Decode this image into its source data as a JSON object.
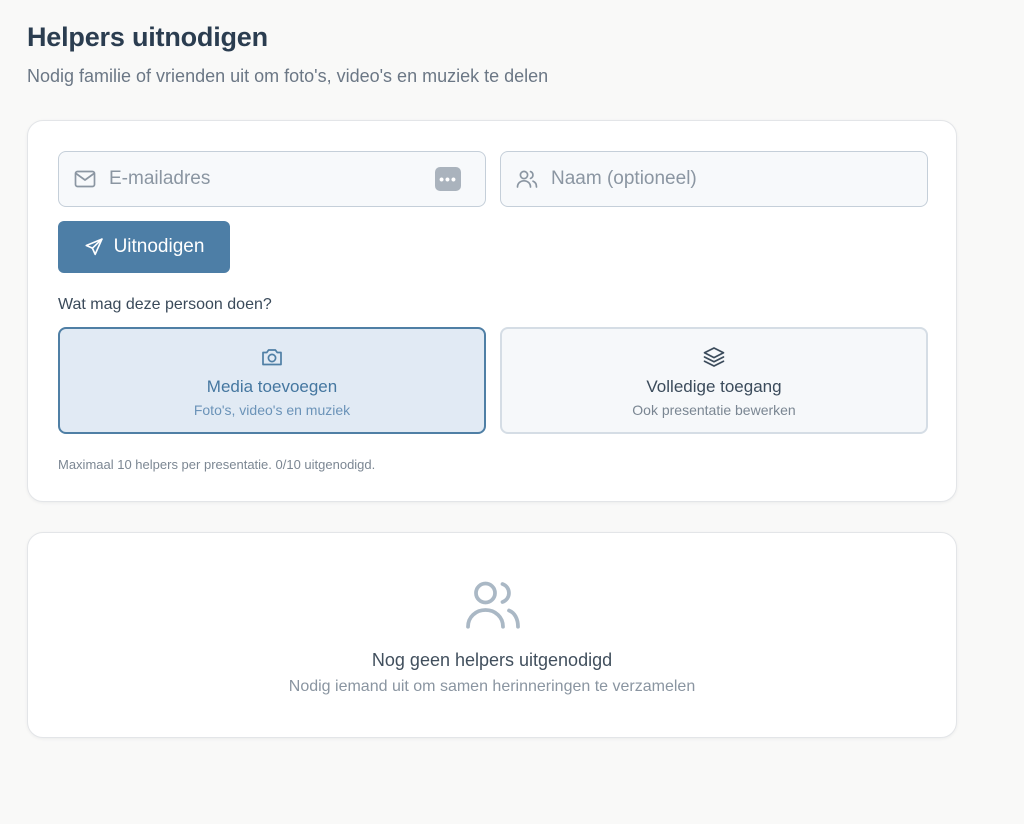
{
  "header": {
    "title": "Helpers uitnodigen",
    "subtitle": "Nodig familie of vrienden uit om foto's, video's en muziek te delen"
  },
  "invite_form": {
    "email": {
      "placeholder": "E-mailadres",
      "value": "",
      "icon": "mail-icon",
      "badge": "•••"
    },
    "name": {
      "placeholder": "Naam (optioneel)",
      "value": "",
      "icon": "users-icon"
    },
    "submit_label": "Uitnodigen",
    "submit_icon": "send-icon"
  },
  "permissions": {
    "label": "Wat mag deze persoon doen?",
    "selected": "media",
    "options": [
      {
        "id": "media",
        "icon": "camera-icon",
        "title": "Media toevoegen",
        "description": "Foto's, video's en muziek"
      },
      {
        "id": "full",
        "icon": "layers-icon",
        "title": "Volledige toegang",
        "description": "Ook presentatie bewerken"
      }
    ]
  },
  "limit_note": "Maximaal 10 helpers per presentatie. 0/10 uitgenodigd.",
  "empty_state": {
    "icon": "users-icon",
    "title": "Nog geen helpers uitgenodigd",
    "description": "Nodig iemand uit om samen herinneringen te verzamelen"
  },
  "colors": {
    "accent": "#4d7ea6",
    "selected_bg": "#e1eaf4",
    "background": "#f9f9f8"
  }
}
